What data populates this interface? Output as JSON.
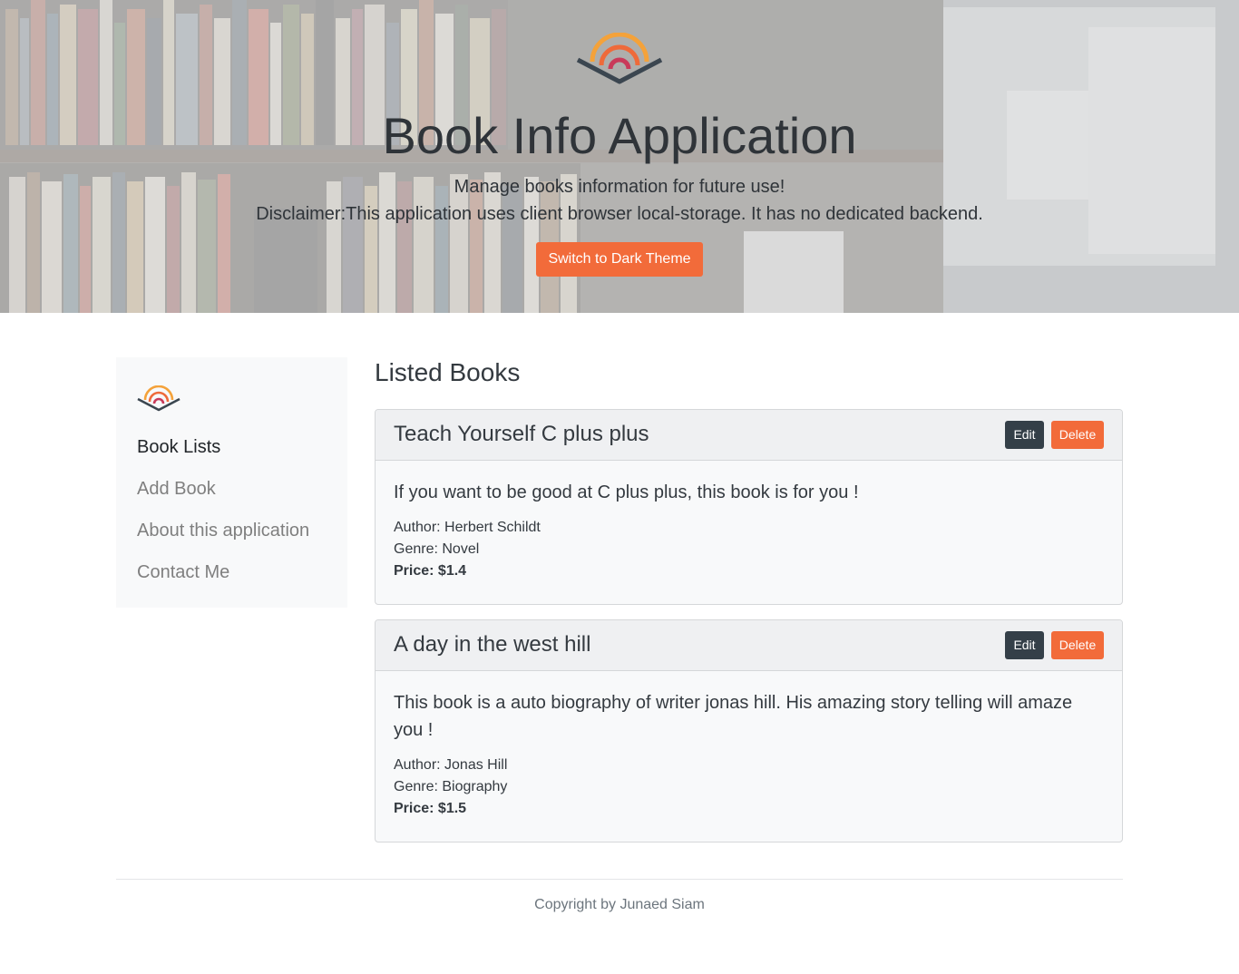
{
  "hero": {
    "title": "Book Info Application",
    "subtitle": "Manage books information for future use!",
    "disclaimer": "Disclaimer:This application uses client browser local-storage. It has no dedicated backend.",
    "theme_button": "Switch to Dark Theme",
    "background": "bookshelf-photo"
  },
  "sidebar": {
    "logo": "book-signal-logo-icon",
    "items": [
      {
        "label": "Book Lists",
        "active": true
      },
      {
        "label": "Add Book",
        "active": false
      },
      {
        "label": "About this application",
        "active": false
      },
      {
        "label": "Contact Me",
        "active": false
      }
    ]
  },
  "main": {
    "title": "Listed Books",
    "books": [
      {
        "title": "Teach Yourself C plus plus",
        "description": "If you want to be good at C plus plus, this book is for you !",
        "author": "Author: Herbert Schildt",
        "genre": "Genre: Novel",
        "price": "Price: $1.4",
        "edit_label": "Edit",
        "delete_label": "Delete"
      },
      {
        "title": "A day in the west hill",
        "description": "This book is a auto biography of writer jonas hill. His amazing story telling will amaze you !",
        "author": "Author: Jonas Hill",
        "genre": "Genre: Biography",
        "price": "Price: $1.5",
        "edit_label": "Edit",
        "delete_label": "Delete"
      }
    ]
  },
  "footer": {
    "text": "Copyright by Junaed Siam"
  },
  "colors": {
    "accent": "#f26b3a",
    "dark_button": "#343f48",
    "text": "#343a40",
    "sidebar_bg": "#f8f9fa"
  }
}
